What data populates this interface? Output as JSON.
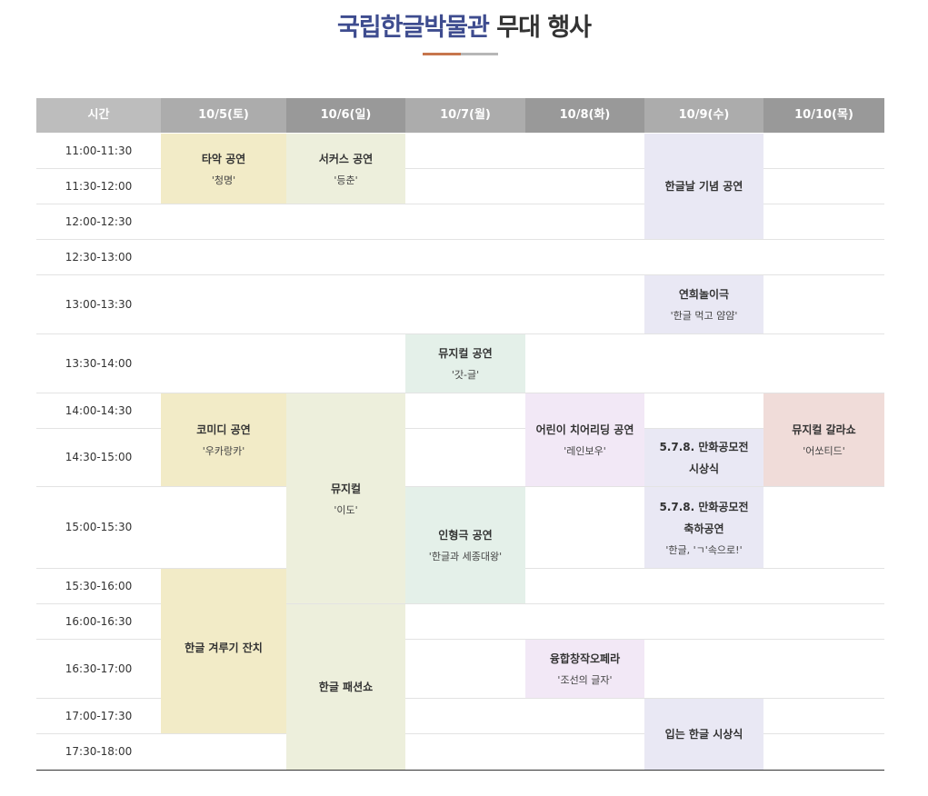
{
  "title": {
    "highlight": "국립한글박물관",
    "rest": " 무대 행사"
  },
  "colors": {
    "title_highlight": "#3e4c8f",
    "accent_underline": "#c7764d",
    "header_time": "#bdbdbd",
    "header_a": "#acacac",
    "header_b": "#999999",
    "yellow": "#f2ebc7",
    "olive": "#edefdc",
    "lavender": "#e9e8f4",
    "mint": "#e4f0e9",
    "pink_lilac": "#f2e8f6",
    "rose": "#f0dcd9"
  },
  "headers": [
    "시간",
    "10/5(토)",
    "10/6(일)",
    "10/7(월)",
    "10/8(화)",
    "10/9(수)",
    "10/10(목)"
  ],
  "times": [
    "11:00-11:30",
    "11:30-12:00",
    "12:00-12:30",
    "12:30-13:00",
    "13:00-13:30",
    "13:30-14:00",
    "14:00-14:30",
    "14:30-15:00",
    "15:00-15:30",
    "15:30-16:00",
    "16:00-16:30",
    "16:30-17:00",
    "17:00-17:30",
    "17:30-18:00"
  ],
  "events": [
    {
      "title": "타악 공연",
      "subtitle": "'청명'",
      "day": 1,
      "startRow": 0,
      "endRow": 1,
      "color": "yellow"
    },
    {
      "title": "서커스 공연",
      "subtitle": "'등춘'",
      "day": 2,
      "startRow": 0,
      "endRow": 1,
      "color": "olive"
    },
    {
      "title": "한글날 기념 공연",
      "subtitle": "",
      "day": 5,
      "startRow": 0,
      "endRow": 2,
      "color": "lavender"
    },
    {
      "title": "연희놀이극",
      "subtitle": "'한글 먹고 얌얌'",
      "day": 5,
      "startRow": 4,
      "endRow": 4,
      "color": "lavender"
    },
    {
      "title": "뮤지컬 공연",
      "subtitle": "'갓-글'",
      "day": 3,
      "startRow": 5,
      "endRow": 5,
      "color": "mint"
    },
    {
      "title": "코미디 공연",
      "subtitle": "'우카랑카'",
      "day": 1,
      "startRow": 6,
      "endRow": 7,
      "color": "yellow"
    },
    {
      "title": "뮤지컬",
      "subtitle": "'이도'",
      "day": 2,
      "startRow": 6,
      "endRow": 9,
      "color": "olive"
    },
    {
      "title": "어린이 치어리딩 공연",
      "subtitle": "'레인보우'",
      "day": 4,
      "startRow": 6,
      "endRow": 7,
      "color": "pink_lilac"
    },
    {
      "title": "5.7.8. 만화공모전 시상식",
      "subtitle": "",
      "day": 5,
      "startRow": 7,
      "endRow": 7,
      "color": "lavender",
      "titleLines": [
        "5.7.8. 만화공모전",
        "시상식"
      ]
    },
    {
      "title": "뮤지컬 갈라쇼",
      "subtitle": "'어쏘티드'",
      "day": 6,
      "startRow": 6,
      "endRow": 7,
      "color": "rose"
    },
    {
      "title": "인형극 공연",
      "subtitle": "'한글과 세종대왕'",
      "day": 3,
      "startRow": 8,
      "endRow": 9,
      "color": "mint"
    },
    {
      "title": "5.7.8. 만화공모전 축하공연",
      "subtitle": "'한글, 'ㄱ'속으로!'",
      "day": 5,
      "startRow": 8,
      "endRow": 8,
      "color": "lavender",
      "titleLines": [
        "5.7.8. 만화공모전",
        "축하공연"
      ]
    },
    {
      "title": "한글 겨루기 잔치",
      "subtitle": "",
      "day": 1,
      "startRow": 9,
      "endRow": 12,
      "color": "yellow",
      "valign": "top"
    },
    {
      "title": "한글 패션쇼",
      "subtitle": "",
      "day": 2,
      "startRow": 10,
      "endRow": 13,
      "color": "olive"
    },
    {
      "title": "융합창작오페라",
      "subtitle": "'조선의 글자'",
      "day": 4,
      "startRow": 11,
      "endRow": 11,
      "color": "pink_lilac"
    },
    {
      "title": "입는 한글 시상식",
      "subtitle": "",
      "day": 5,
      "startRow": 12,
      "endRow": 13,
      "color": "lavender"
    }
  ]
}
